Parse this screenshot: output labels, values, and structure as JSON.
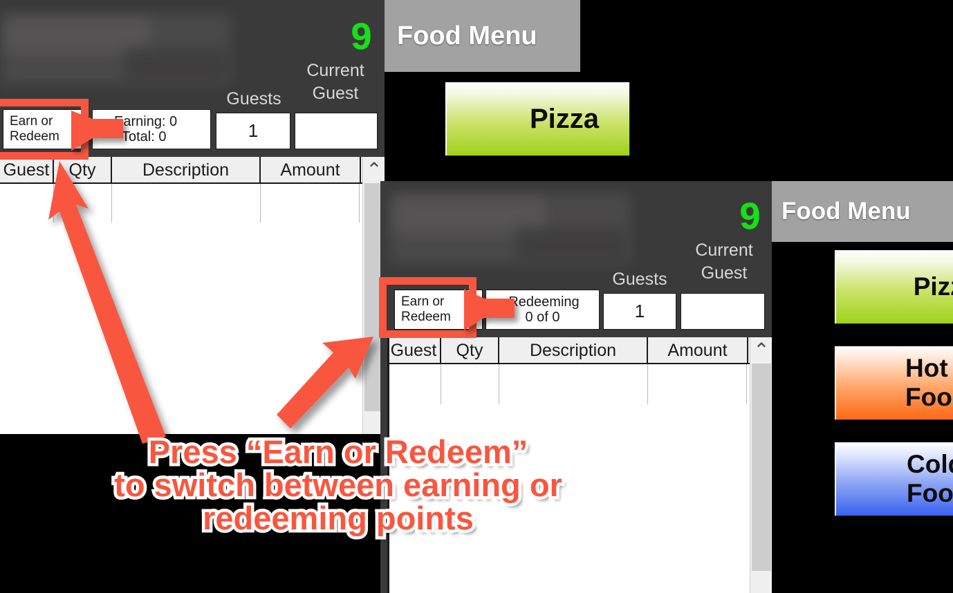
{
  "colors": {
    "accent_red": "#f9563f",
    "green_number": "#18e018",
    "panel_bg": "#3a3a3a",
    "menu_header_bg": "#a2a2a2",
    "btn_green": "#9fd21b",
    "btn_orange": "#fa6a14",
    "btn_blue": "#3a63ef"
  },
  "panel_top": {
    "points_badge": "9",
    "current_guest_label_line1": "Current",
    "current_guest_label_line2": "Guest",
    "guests_label": "Guests",
    "earn_or_redeem_line1": "Earn or",
    "earn_or_redeem_line2": "Redeem",
    "status_line1": "Earning: 0",
    "status_line2": "Total: 0",
    "guests_value": "1",
    "current_guest_value": "",
    "table": {
      "columns": [
        "Guest",
        "Qty",
        "Description",
        "Amount"
      ],
      "rows": []
    },
    "scroll_up_icon": "⌃"
  },
  "panel_bottom": {
    "points_badge": "9",
    "current_guest_label_line1": "Current",
    "current_guest_label_line2": "Guest",
    "guests_label": "Guests",
    "earn_or_redeem_line1": "Earn or",
    "earn_or_redeem_line2": "Redeem",
    "status_line1": "Redeeming",
    "status_line2": "0 of 0",
    "guests_value": "1",
    "current_guest_value": "",
    "table": {
      "columns": [
        "Guest",
        "Qty",
        "Description",
        "Amount"
      ],
      "rows": []
    },
    "scroll_up_icon": "⌃"
  },
  "food_menu_top": {
    "title": "Food Menu",
    "buttons": [
      {
        "label": "Pizza",
        "color": "green"
      }
    ]
  },
  "food_menu_bottom": {
    "title": "Food Menu",
    "buttons": [
      {
        "label": "Pizza",
        "color": "green"
      },
      {
        "label": "Hot Food",
        "color": "orange"
      },
      {
        "label": "Cold Food",
        "color": "blue"
      }
    ]
  },
  "annotation": {
    "caption_line1": "Press “Earn or Redeem”",
    "caption_line2": "to switch between earning or",
    "caption_line3": "redeeming points",
    "highlight_label": "Earn or Redeem"
  }
}
